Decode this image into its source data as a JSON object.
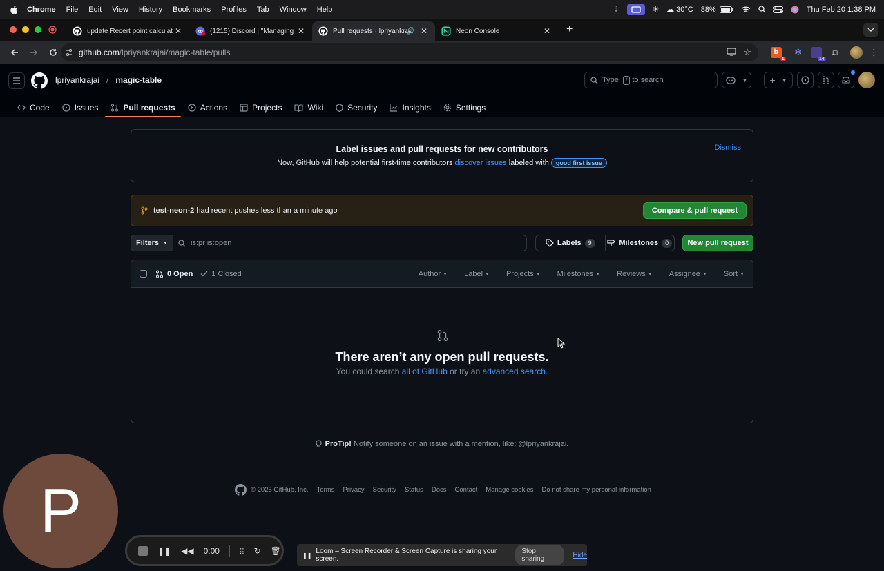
{
  "menubar": {
    "items": [
      "Chrome",
      "File",
      "Edit",
      "View",
      "History",
      "Bookmarks",
      "Profiles",
      "Tab",
      "Window",
      "Help"
    ],
    "temperature": "30°C",
    "battery": "88%",
    "datetime": "Thu Feb 20  1:38 PM"
  },
  "tabs": [
    {
      "title": "update Recert point calculati",
      "favicon": "github-icon"
    },
    {
      "title": "(1215) Discord | \"Managing N",
      "favicon": "discord-icon"
    },
    {
      "title": "Pull requests · lpriyankraja",
      "favicon": "github-icon",
      "active": true
    },
    {
      "title": "Neon Console",
      "favicon": "neon-icon"
    }
  ],
  "toolbar": {
    "url_host": "github.com",
    "url_path": "/lpriyankrajai/magic-table/pulls",
    "ext_badge_1": "1",
    "ext_badge_2": "14"
  },
  "header": {
    "owner": "lpriyankrajai",
    "separator": "/",
    "repo": "magic-table",
    "search_prefix": "Type",
    "search_key": "/",
    "search_suffix": "to search"
  },
  "repo_nav": [
    {
      "label": "Code",
      "icon": "code-icon"
    },
    {
      "label": "Issues",
      "icon": "issue-icon"
    },
    {
      "label": "Pull requests",
      "icon": "pull-request-icon",
      "active": true
    },
    {
      "label": "Actions",
      "icon": "play-icon"
    },
    {
      "label": "Projects",
      "icon": "table-icon"
    },
    {
      "label": "Wiki",
      "icon": "book-icon"
    },
    {
      "label": "Security",
      "icon": "shield-icon"
    },
    {
      "label": "Insights",
      "icon": "graph-icon"
    },
    {
      "label": "Settings",
      "icon": "gear-icon"
    }
  ],
  "banner": {
    "title": "Label issues and pull requests for new contributors",
    "text_before": "Now, GitHub will help potential first-time contributors ",
    "link": "discover issues",
    "text_after": " labeled with ",
    "label": "good first issue",
    "dismiss": "Dismiss"
  },
  "push_notice": {
    "branch": "test-neon-2",
    "text": " had recent pushes less than a minute ago",
    "button": "Compare & pull request"
  },
  "filters": {
    "button": "Filters",
    "query": "is:pr is:open",
    "labels": "Labels",
    "labels_count": "9",
    "milestones": "Milestones",
    "milestones_count": "0",
    "new_pr": "New pull request"
  },
  "list": {
    "open": "0 Open",
    "closed": "1 Closed",
    "sorts": [
      "Author",
      "Label",
      "Projects",
      "Milestones",
      "Reviews",
      "Assignee",
      "Sort"
    ],
    "empty_title": "There aren’t any open pull requests.",
    "empty_pre": "You could search ",
    "empty_link1": "all of GitHub",
    "empty_mid": " or try an ",
    "empty_link2": "advanced search",
    "empty_post": "."
  },
  "protip": {
    "bold": "ProTip!",
    "text": " Notify someone on an issue with a mention, like: @lpriyankrajai."
  },
  "footer": {
    "copyright": "© 2025 GitHub, Inc.",
    "links": [
      "Terms",
      "Privacy",
      "Security",
      "Status",
      "Docs",
      "Contact",
      "Manage cookies",
      "Do not share my personal information"
    ]
  },
  "overlay": {
    "camera_initial": "P",
    "timer": "0:00",
    "share_text": "Loom – Screen Recorder & Screen Capture is sharing your screen.",
    "stop_sharing": "Stop sharing",
    "hide": "Hide"
  },
  "colors": {
    "accent_link": "#4493f8",
    "green_button": "#238636",
    "active_tab_underline": "#f78166",
    "background": "#0d1117"
  }
}
